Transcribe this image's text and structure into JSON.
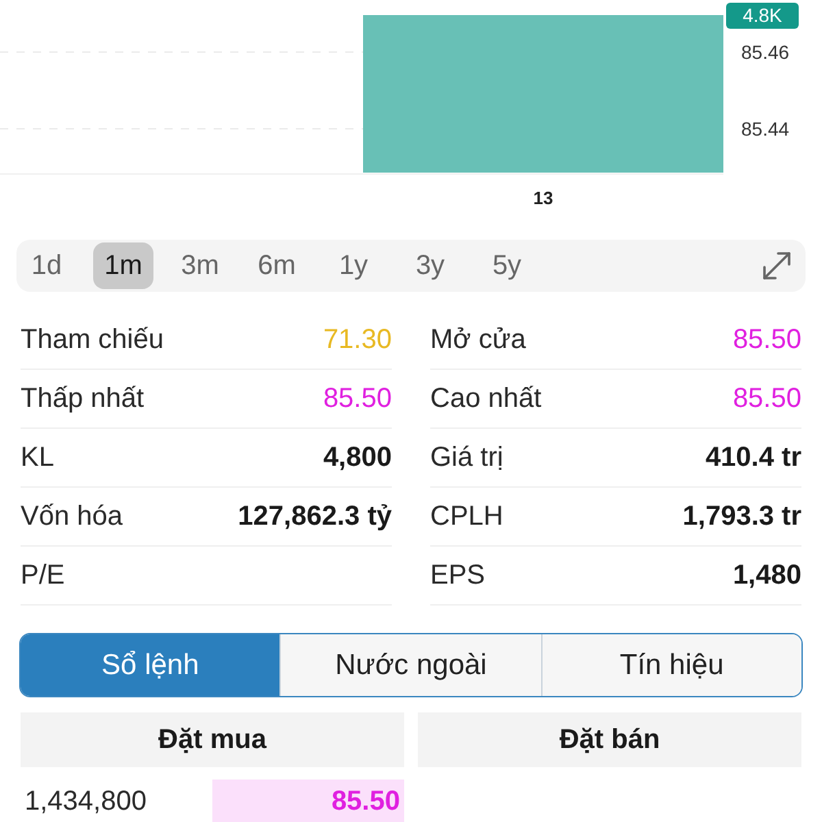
{
  "chart": {
    "badge": "4.8K",
    "y_axis_labels": [
      "85.46",
      "85.44"
    ],
    "x_axis_labels": [
      "13"
    ]
  },
  "periods": [
    {
      "label": "1d",
      "selected": false
    },
    {
      "label": "1m",
      "selected": true
    },
    {
      "label": "3m",
      "selected": false
    },
    {
      "label": "6m",
      "selected": false
    },
    {
      "label": "1y",
      "selected": false
    },
    {
      "label": "3y",
      "selected": false
    },
    {
      "label": "5y",
      "selected": false
    }
  ],
  "stats": [
    {
      "label": "Tham chiếu",
      "value": "71.30",
      "color": "#e8b923"
    },
    {
      "label": "Mở cửa",
      "value": "85.50",
      "color": "#e020e0"
    },
    {
      "label": "Thấp nhất",
      "value": "85.50",
      "color": "#e020e0"
    },
    {
      "label": "Cao nhất",
      "value": "85.50",
      "color": "#e020e0"
    },
    {
      "label": "KL",
      "value": "4,800"
    },
    {
      "label": "Giá trị",
      "value": "410.4 tr"
    },
    {
      "label": "Vốn hóa",
      "value": "127,862.3 tỷ"
    },
    {
      "label": "CPLH",
      "value": "1,793.3 tr"
    },
    {
      "label": "P/E"
    },
    {
      "label": "EPS",
      "value": "1,480"
    }
  ],
  "tabs": [
    {
      "label": "Sổ lệnh",
      "selected": true
    },
    {
      "label": "Nước ngoài",
      "selected": false
    },
    {
      "label": "Tín hiệu",
      "selected": false
    }
  ],
  "order_book": {
    "columns": [
      "Đặt mua",
      "Đặt bán"
    ],
    "rows": [
      {
        "volume": "1,434,800",
        "price": "85.50",
        "color": "#e020e0"
      }
    ]
  }
}
